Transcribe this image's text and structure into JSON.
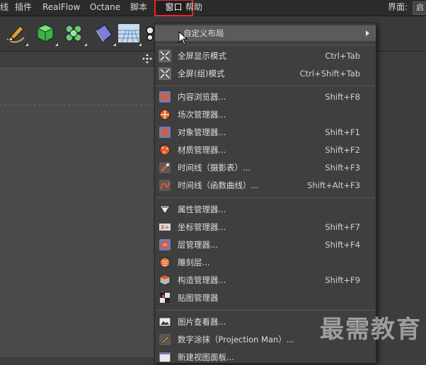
{
  "menubar": {
    "items": [
      "线",
      "插件",
      "RealFlow",
      "Octane",
      "脚本",
      "窗口",
      "帮助"
    ],
    "active_item": "窗口",
    "layout_label": "界面:",
    "layout_value": "启"
  },
  "toolbar": {
    "icons": [
      "pen-tool-icon",
      "cube-generator-icon",
      "cloner-icon",
      "deformer-icon",
      "floor-scene-icon",
      "camera-icon"
    ]
  },
  "viewport": {
    "nav_icon": "move-navigation-icon"
  },
  "window_menu": {
    "custom_layout": {
      "label": "自定义布局",
      "has_submenu": true
    },
    "fullscreen": [
      {
        "label": "全屏显示模式",
        "shortcut": "Ctrl+Tab",
        "icon": "fullscreen-icon"
      },
      {
        "label": "全屏(组)模式",
        "shortcut": "Ctrl+Shift+Tab",
        "icon": "fullscreen-group-icon"
      }
    ],
    "managers": [
      {
        "label": "内容浏览器...",
        "shortcut": "Shift+F8",
        "icon": "content-browser-icon"
      },
      {
        "label": "场次管理器...",
        "shortcut": "",
        "icon": "take-manager-icon"
      },
      {
        "label": "对象管理器...",
        "shortcut": "Shift+F1",
        "icon": "object-manager-icon"
      },
      {
        "label": "材质管理器...",
        "shortcut": "Shift+F2",
        "icon": "material-manager-icon"
      },
      {
        "label": "时间线（摄影表）...",
        "shortcut": "Shift+F3",
        "icon": "timeline-dopesheet-icon"
      },
      {
        "label": "时间线（函数曲线）...",
        "shortcut": "Shift+Alt+F3",
        "icon": "timeline-fcurve-icon"
      }
    ],
    "editors": [
      {
        "label": "属性管理器...",
        "shortcut": "",
        "icon": "attribute-manager-icon"
      },
      {
        "label": "坐标管理器...",
        "shortcut": "Shift+F7",
        "icon": "coordinate-manager-icon"
      },
      {
        "label": "层管理器...",
        "shortcut": "Shift+F4",
        "icon": "layer-manager-icon"
      },
      {
        "label": "雕刻层...",
        "shortcut": "",
        "icon": "sculpt-layer-icon"
      },
      {
        "label": "构造管理器...",
        "shortcut": "Shift+F9",
        "icon": "structure-manager-icon"
      },
      {
        "label": "贴图管理器",
        "shortcut": "",
        "icon": "texture-manager-icon"
      }
    ],
    "viewers": [
      {
        "label": "图片查看器...",
        "shortcut": "",
        "icon": "picture-viewer-icon"
      },
      {
        "label": "数字涂抹（Projection Man）...",
        "shortcut": "",
        "icon": "projection-man-icon"
      },
      {
        "label": "新建视图面板...",
        "shortcut": "",
        "icon": "new-view-panel-icon"
      }
    ]
  },
  "watermark": "最需教育",
  "colors": {
    "menubar_bg": "#2b2b2b",
    "menu_bg": "#3f3f3f",
    "highlight_bg": "#5b5b5b",
    "active_outline": "#e6262a"
  }
}
